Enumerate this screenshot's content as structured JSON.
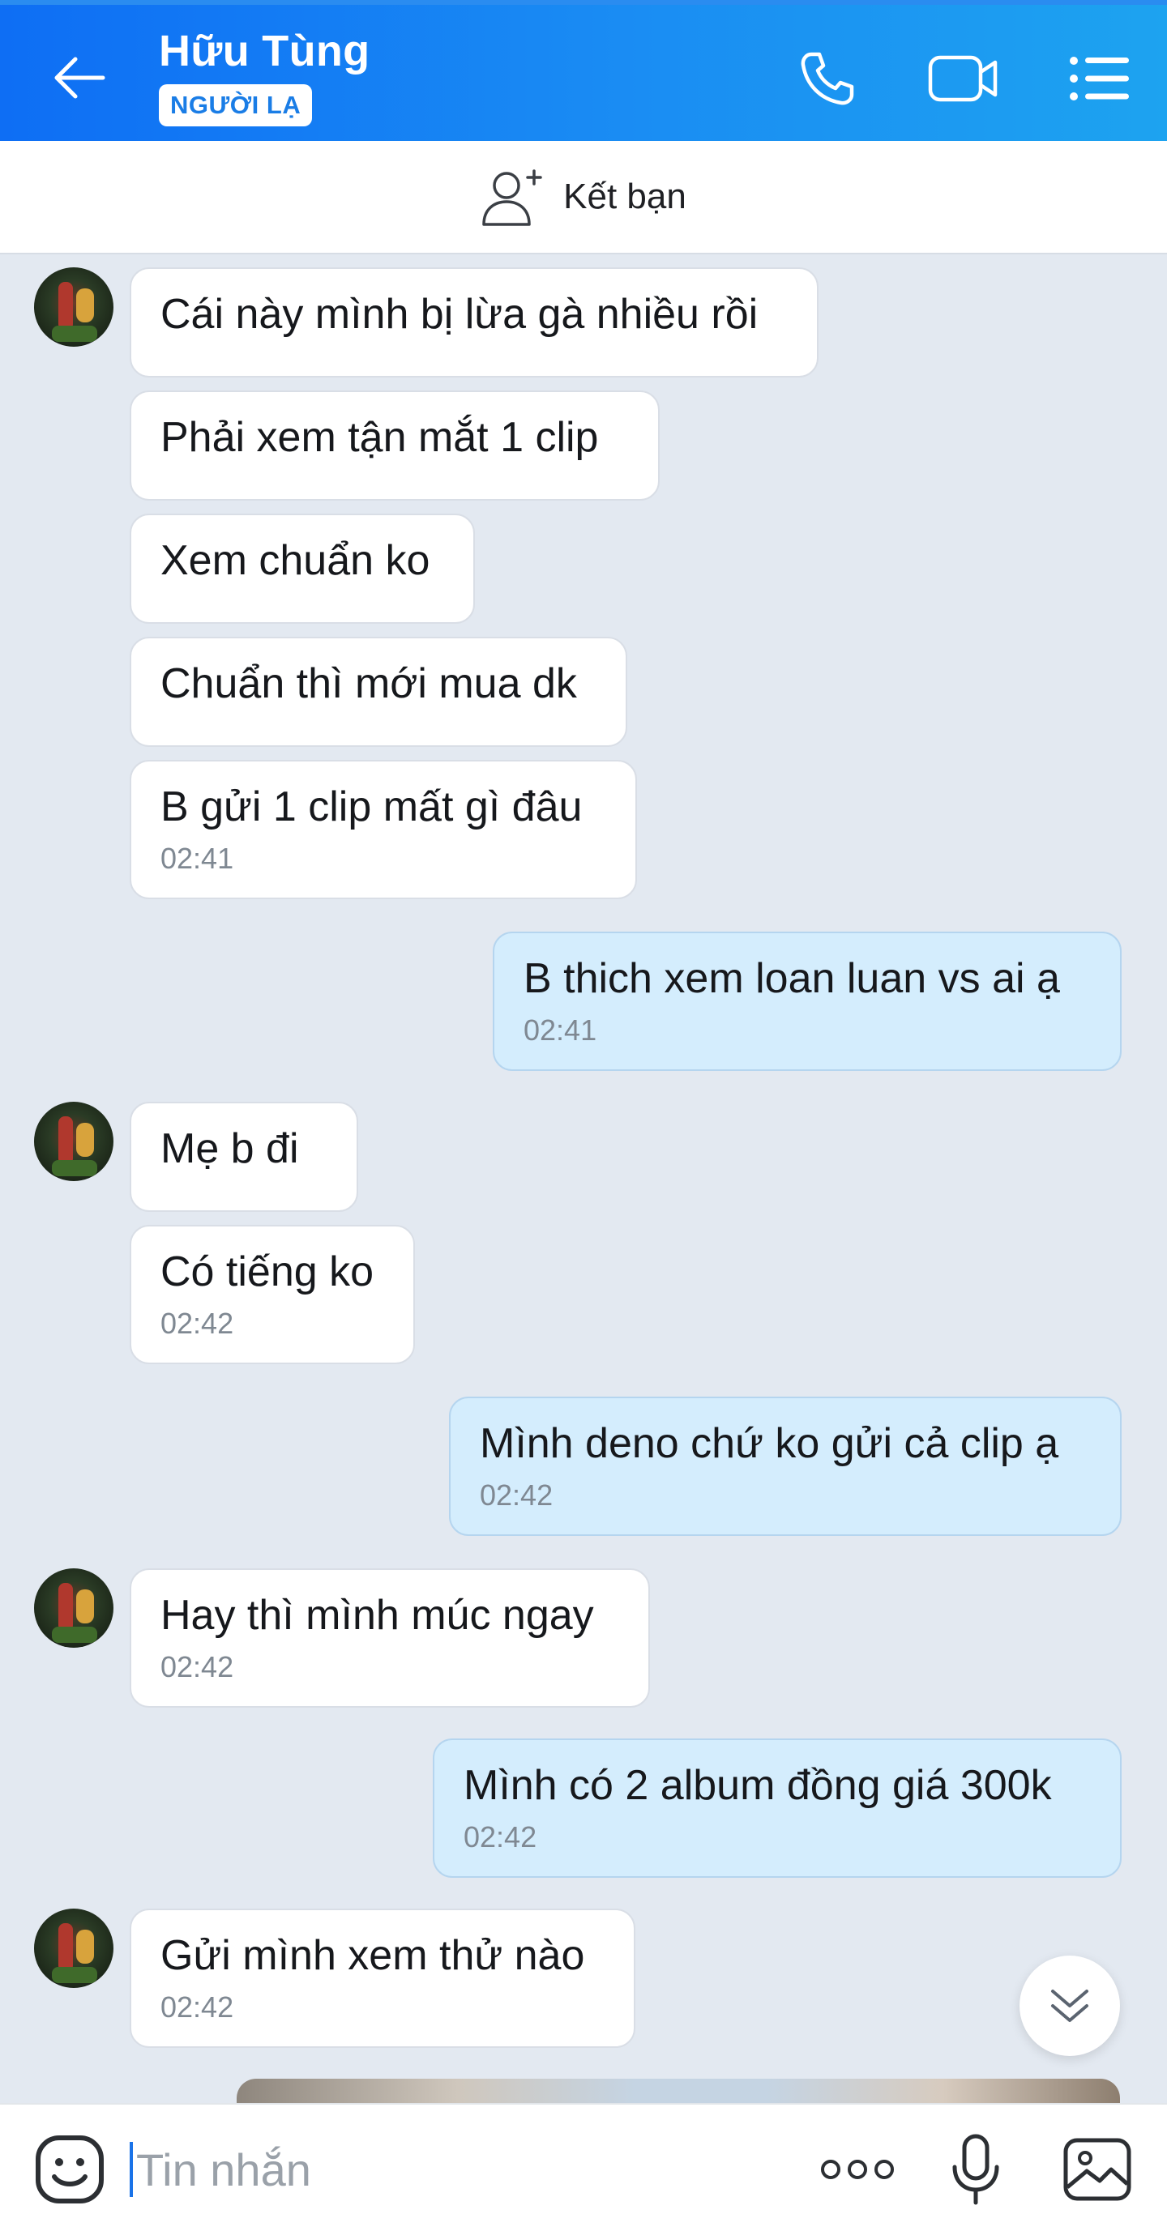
{
  "header": {
    "contact_name": "Hữu Tùng",
    "badge": "NGƯỜI LẠ",
    "gradient_colors": [
      "#0e6ef4",
      "#1da3f0"
    ]
  },
  "friend_bar": {
    "label": "Kết bạn"
  },
  "messages": [
    {
      "from": "them",
      "text": "Cái này mình bị lừa gà nhiều rồi",
      "time": ""
    },
    {
      "from": "them",
      "text": "Phải xem tận mắt 1 clip",
      "time": ""
    },
    {
      "from": "them",
      "text": "Xem chuẩn ko",
      "time": ""
    },
    {
      "from": "them",
      "text": "Chuẩn thì mới mua dk",
      "time": ""
    },
    {
      "from": "them",
      "text": "B gửi 1 clip mất gì đâu",
      "time": "02:41"
    },
    {
      "from": "me",
      "text": "B thich xem loan luan vs ai ạ",
      "time": "02:41"
    },
    {
      "from": "them",
      "text": "Mẹ b đi",
      "time": ""
    },
    {
      "from": "them",
      "text": "Có tiếng ko",
      "time": "02:42"
    },
    {
      "from": "me",
      "text": "Mình deno chứ ko gửi cả clip ạ",
      "time": "02:42"
    },
    {
      "from": "them",
      "text": "Hay thì mình múc ngay",
      "time": "02:42"
    },
    {
      "from": "me",
      "text": "Mình có 2 album đồng giá 300k",
      "time": "02:42"
    },
    {
      "from": "them",
      "text": "Gửi mình xem thử nào",
      "time": "02:42"
    }
  ],
  "input_bar": {
    "placeholder": "Tin nhắn"
  },
  "colors": {
    "chat_background": "#e3e9f1",
    "incoming_bubble": "#ffffff",
    "outgoing_bubble": "#d4edfd",
    "accent": "#1a7de6"
  }
}
